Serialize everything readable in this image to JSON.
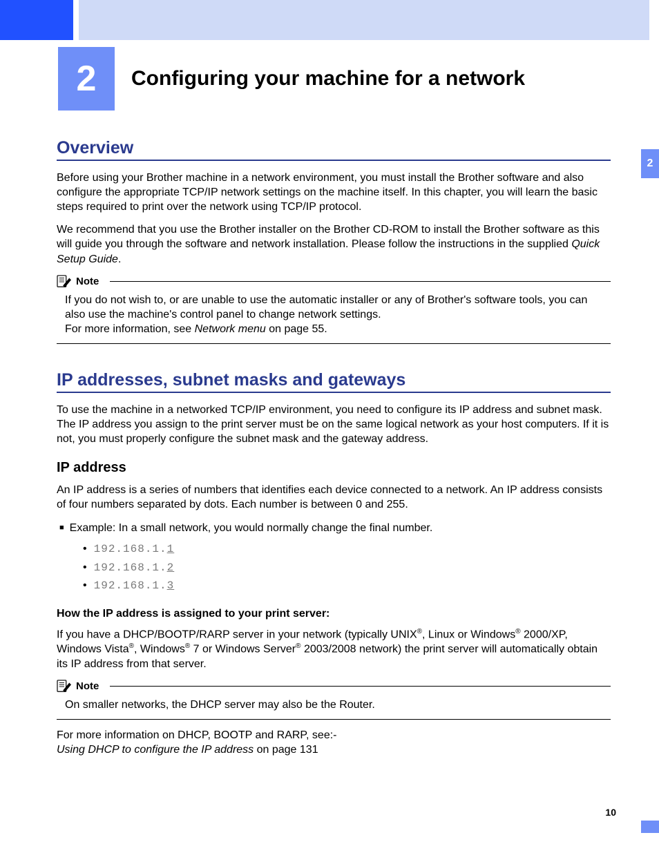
{
  "chapter": {
    "number": "2",
    "title": "Configuring your machine for a network"
  },
  "side_tab": "2",
  "page_number": "10",
  "overview": {
    "heading": "Overview",
    "p1a": "Before using your Brother machine in a network environment, you must install the Brother software and also configure the appropriate TCP/IP network settings on the machine itself. In this chapter, you will learn the basic steps required to print over the network using TCP/IP protocol.",
    "p2a": "We recommend that you use the Brother installer on the Brother CD-ROM to install the Brother software as this will guide you through the software and network installation. Please follow the instructions in the supplied ",
    "p2b_italic": "Quick Setup Guide",
    "p2c": ".",
    "note_label": "Note",
    "note_body_a": "If you do not wish to, or are unable to use the automatic installer or any of Brother's software tools, you can also use the machine's control panel to change network settings.",
    "note_body_b1": "For more information, see ",
    "note_body_b2_italic": "Network menu",
    "note_body_b3": " on page 55."
  },
  "ip_section": {
    "heading": "IP addresses, subnet masks and gateways",
    "intro": "To use the machine in a networked TCP/IP environment, you need to configure its IP address and subnet mask. The IP address you assign to the print server must be on the same logical network as your host computers. If it is not, you must properly configure the subnet mask and the gateway address.",
    "ipaddr_heading": "IP address",
    "ipaddr_p": "An IP address is a series of numbers that identifies each device connected to a network. An IP address consists of four numbers separated by dots. Each number is between 0 and 255.",
    "example_label": "Example: In a small network, you would normally change the final number.",
    "ips": {
      "prefix": "192.168.1.",
      "a": "1",
      "b": "2",
      "c": "3"
    },
    "how_heading": "How the IP address is assigned to your print server:",
    "how_p_a": "If you have a DHCP/BOOTP/RARP server in your network (typically UNIX",
    "how_p_b": ", Linux or Windows",
    "how_p_c": " 2000/XP, Windows Vista",
    "how_p_d": ", Windows",
    "how_p_e": " 7 or Windows Server",
    "how_p_f": " 2003/2008 network) the print server will automatically obtain its IP address from that server.",
    "reg": "®",
    "note2_label": "Note",
    "note2_body": "On smaller networks, the DHCP server may also be the Router.",
    "more_a": "For more information on DHCP, BOOTP and RARP, see:-",
    "more_b_italic": "Using DHCP to configure the IP address",
    "more_b_tail": " on page 131"
  }
}
